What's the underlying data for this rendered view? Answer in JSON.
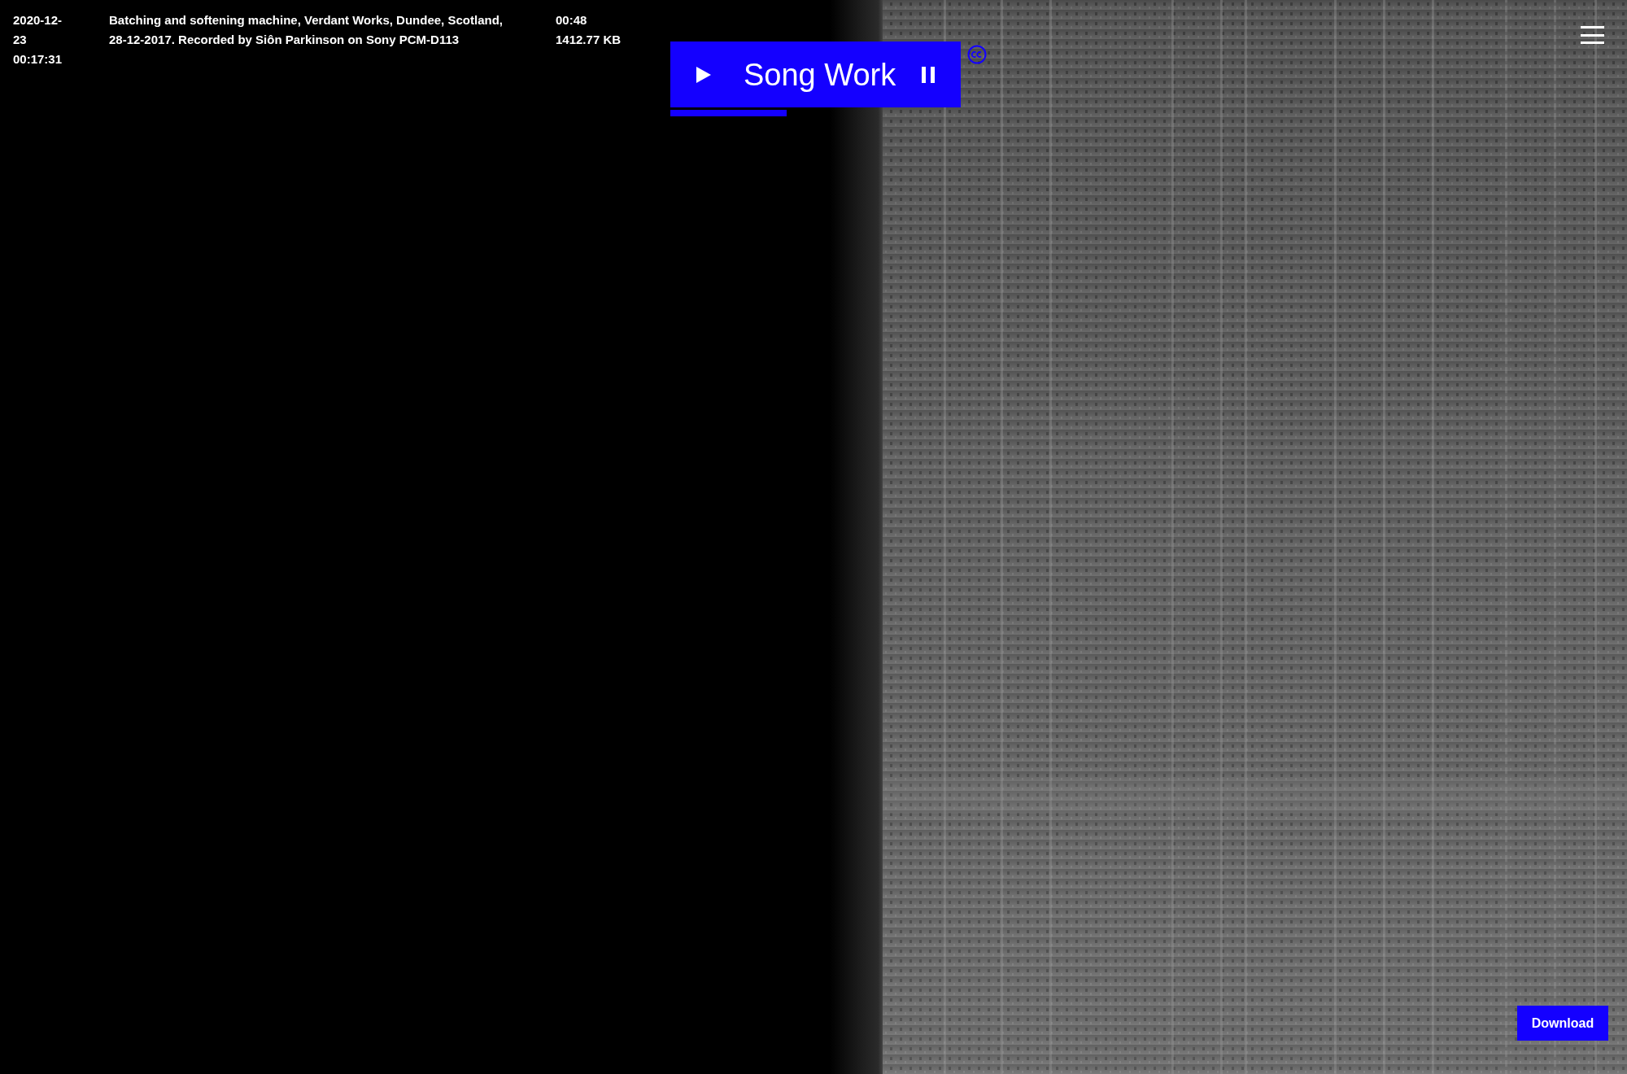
{
  "recording": {
    "date": "2020-12-23 00:17:31",
    "description": "Batching and softening machine, Verdant Works, Dundee, Scotland, 28-12-2017. Recorded by Siôn Parkinson on Sony PCM-D113",
    "duration": "00:48",
    "size": "1412.77 KB"
  },
  "player": {
    "title": "Song Work",
    "level": 0.4
  },
  "download_button": "Download"
}
